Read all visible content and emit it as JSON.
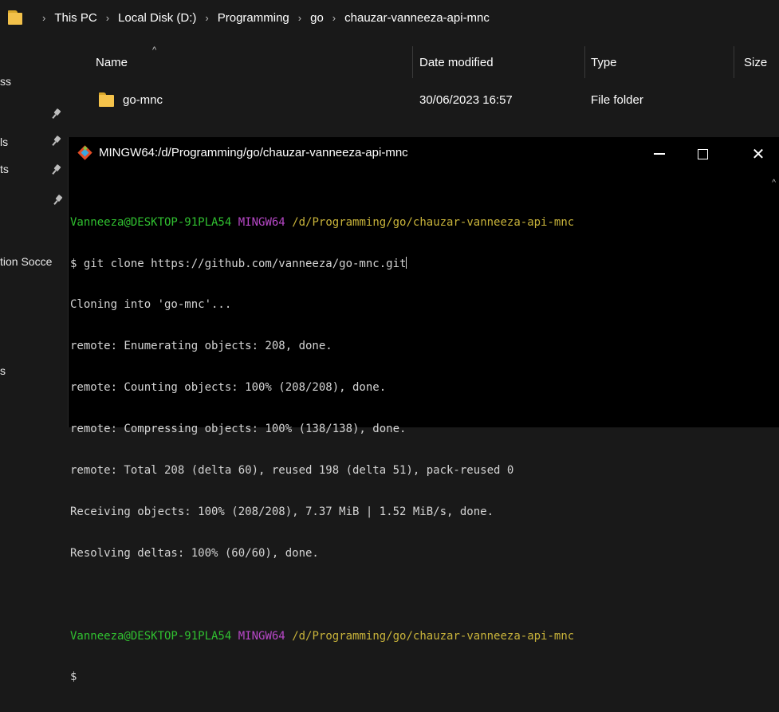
{
  "explorer": {
    "breadcrumb": [
      "This PC",
      "Local Disk (D:)",
      "Programming",
      "go",
      "chauzar-vanneeza-api-mnc"
    ],
    "nav_items": [
      "ss",
      "ls",
      "ts",
      "tion Socce",
      "s"
    ],
    "columns": {
      "name": "Name",
      "date": "Date modified",
      "type": "Type",
      "size": "Size"
    },
    "rows": [
      {
        "name": "go-mnc",
        "date": "30/06/2023 16:57",
        "type": "File folder",
        "size": ""
      }
    ],
    "colors": {
      "folder": "#f5c34b",
      "background": "#191919"
    }
  },
  "terminal": {
    "title": "MINGW64:/d/Programming/go/chauzar-vanneeza-api-mnc",
    "icon": "git-bash-icon",
    "prompt": {
      "user": "Vanneeza@DESKTOP-91PLA54",
      "system": "MINGW64",
      "path": "/d/Programming/go/chauzar-vanneeza-api-mnc"
    },
    "command": "$ git clone https://github.com/vanneeza/go-mnc.git",
    "output": [
      "Cloning into 'go-mnc'...",
      "remote: Enumerating objects: 208, done.",
      "remote: Counting objects: 100% (208/208), done.",
      "remote: Compressing objects: 100% (138/138), done.",
      "remote: Total 208 (delta 60), reused 198 (delta 51), pack-reused 0",
      "Receiving objects: 100% (208/208), 7.37 MiB | 1.52 MiB/s, done.",
      "Resolving deltas: 100% (60/60), done."
    ],
    "prompt2_symbol": "$",
    "colors": {
      "user": "#30c030",
      "system": "#b848c8",
      "path": "#c8b33a",
      "text": "#d4d4d4"
    }
  }
}
